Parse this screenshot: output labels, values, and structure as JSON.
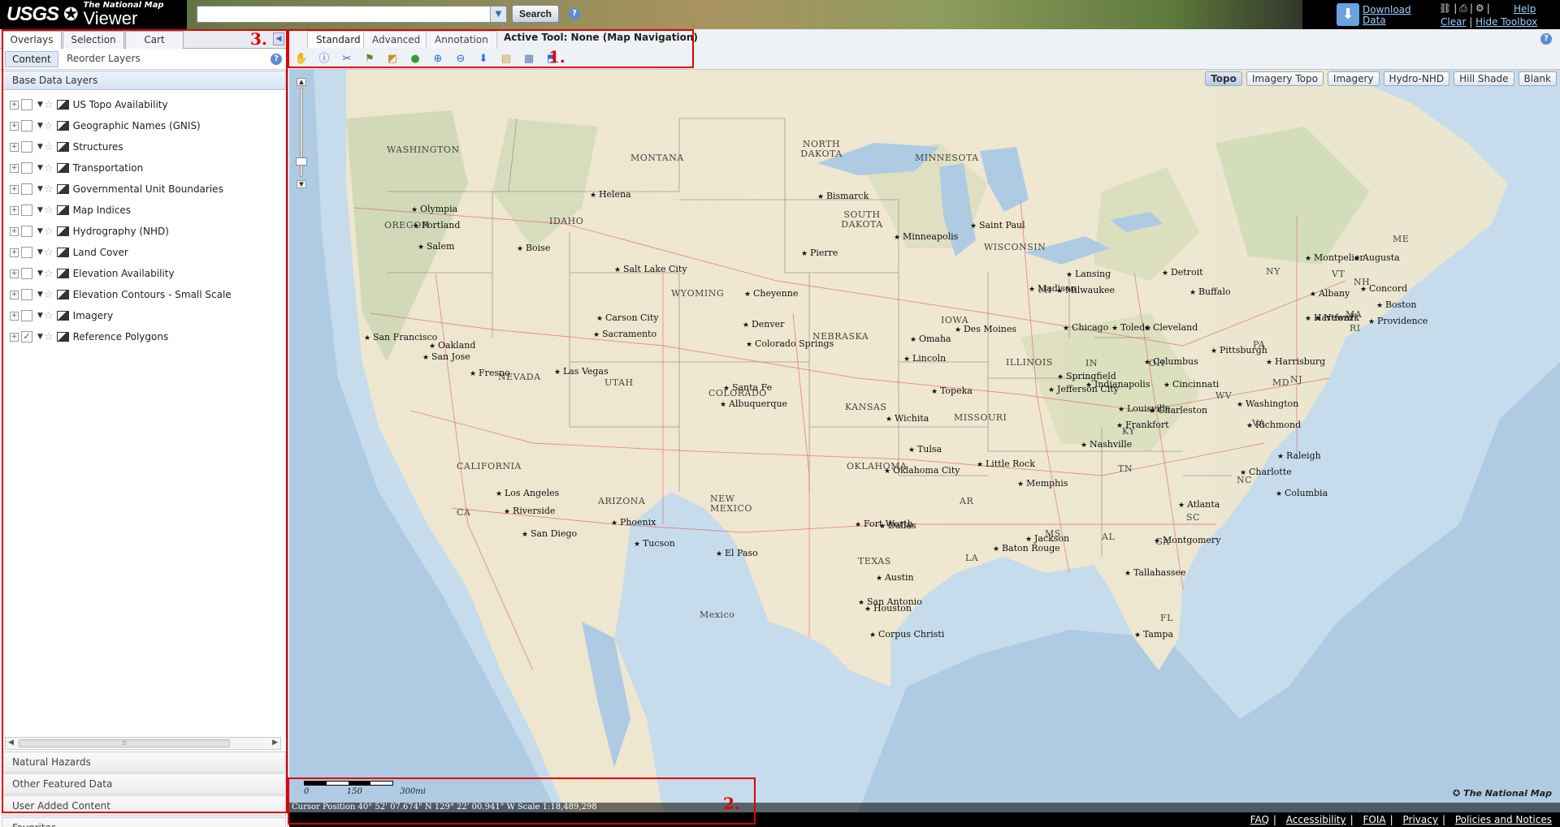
{
  "header": {
    "logo_usgs": "USGS",
    "logo_tnm_small": "The National Map",
    "logo_tnm_big": "Viewer",
    "search_value": "",
    "search_label": "Search",
    "download_label_1": "Download",
    "download_label_2": "Data",
    "help_label": "Help",
    "clear_label": "Clear",
    "hide_toolbox_label": "Hide Toolbox",
    "link_sep": "|"
  },
  "left_panel": {
    "tabs": [
      "Overlays",
      "Selection",
      "Cart"
    ],
    "subtabs": [
      "Content",
      "Reorder Layers"
    ],
    "base_header": "Base Data Layers",
    "layers": [
      {
        "label": "US Topo Availability",
        "checked": ""
      },
      {
        "label": "Geographic Names (GNIS)",
        "checked": ""
      },
      {
        "label": "Structures",
        "checked": ""
      },
      {
        "label": "Transportation",
        "checked": ""
      },
      {
        "label": "Governmental Unit Boundaries",
        "checked": ""
      },
      {
        "label": "Map Indices",
        "checked": ""
      },
      {
        "label": "Hydrography (NHD)",
        "checked": ""
      },
      {
        "label": "Land Cover",
        "checked": ""
      },
      {
        "label": "Elevation Availability",
        "checked": ""
      },
      {
        "label": "Elevation Contours - Small Scale",
        "checked": ""
      },
      {
        "label": "Imagery",
        "checked": ""
      },
      {
        "label": "Reference Polygons",
        "checked": "✓"
      }
    ],
    "accordion": [
      "Natural Hazards",
      "Other Featured Data",
      "User Added Content",
      "Favorites"
    ]
  },
  "toolbar": {
    "tabs": [
      "Standard",
      "Advanced",
      "Annotation"
    ],
    "active_tool": "Active Tool: None (Map Navigation)",
    "tools": [
      {
        "name": "pan-hand-icon",
        "glyph": "✋",
        "color": "#d08a1a"
      },
      {
        "name": "identify-info-icon",
        "glyph": "ⓘ",
        "color": "#2a6bd0"
      },
      {
        "name": "measure-icon",
        "glyph": "✂",
        "color": "#2a6bd0"
      },
      {
        "name": "flag-icon",
        "glyph": "⚑",
        "color": "#5a8a2a"
      },
      {
        "name": "bookmark-icon",
        "glyph": "◩",
        "color": "#d08a1a"
      },
      {
        "name": "globe-icon",
        "glyph": "●",
        "color": "#3a9a3a"
      },
      {
        "name": "zoom-in-icon",
        "glyph": "⊕",
        "color": "#2a6bd0"
      },
      {
        "name": "zoom-out-icon",
        "glyph": "⊖",
        "color": "#2a6bd0"
      },
      {
        "name": "download-icon",
        "glyph": "⬇",
        "color": "#2a6bd0"
      },
      {
        "name": "legend-icon",
        "glyph": "▤",
        "color": "#c8a040"
      },
      {
        "name": "print-icon",
        "glyph": "▦",
        "color": "#5a7ab0"
      },
      {
        "name": "share-icon",
        "glyph": "⬒",
        "color": "#2a6bd0"
      }
    ]
  },
  "map": {
    "basemaps": [
      "Topo",
      "Imagery Topo",
      "Imagery",
      "Hydro-NHD",
      "Hill Shade",
      "Blank"
    ],
    "scale_ticks": [
      "0",
      "150",
      "300mi"
    ],
    "watermark": "The National Map",
    "cursor_text": "Cursor Position  40° 52' 07.674\" N     129° 22' 00.941\" W        Scale  1:18,489,298",
    "states": [
      "WASHINGTON",
      "MONTANA",
      "NORTH DAKOTA",
      "MINNESOTA",
      "OREGON",
      "IDAHO",
      "SOUTH DAKOTA",
      "WISCONSIN",
      "WYOMING",
      "IOWA",
      "NEBRASKA",
      "NEVADA",
      "UTAH",
      "COLORADO",
      "KANSAS",
      "MISSOURI",
      "ILLINOIS",
      "CALIFORNIA",
      "ARIZONA",
      "NEW MEXICO",
      "OKLAHOMA",
      "TEXAS",
      "MI",
      "IN",
      "OH",
      "PA",
      "NY",
      "VT",
      "NH",
      "ME",
      "MA",
      "RI",
      "WV",
      "VA",
      "KY",
      "TN",
      "AR",
      "MS",
      "AL",
      "GA",
      "SC",
      "NC",
      "LA",
      "FL",
      "MD",
      "NJ",
      "CA",
      "Mexico"
    ],
    "cities": [
      "Olympia",
      "Portland",
      "Salem",
      "Helena",
      "Bismarck",
      "Boise",
      "Pierre",
      "Minneapolis",
      "Saint Paul",
      "Salt Lake City",
      "Cheyenne",
      "Carson City",
      "Sacramento",
      "San Francisco",
      "Oakland",
      "San Jose",
      "Fresno",
      "Las Vegas",
      "Los Angeles",
      "Riverside",
      "San Diego",
      "Phoenix",
      "Tucson",
      "Santa Fe",
      "Albuquerque",
      "El Paso",
      "Denver",
      "Colorado Springs",
      "Lincoln",
      "Omaha",
      "Des Moines",
      "Madison",
      "Milwaukee",
      "Chicago",
      "Lansing",
      "Detroit",
      "Toledo",
      "Cleveland",
      "Buffalo",
      "Montpelier",
      "Augusta",
      "Concord",
      "Albany",
      "Boston",
      "Hartford",
      "Providence",
      "Pittsburgh",
      "Harrisburg",
      "Newark",
      "Columbus",
      "Indianapolis",
      "Springfield",
      "Jefferson City",
      "Topeka",
      "Wichita",
      "Tulsa",
      "Oklahoma City",
      "Little Rock",
      "Memphis",
      "Nashville",
      "Louisville",
      "Frankfort",
      "Cincinnati",
      "Charleston",
      "Washington",
      "Richmond",
      "Raleigh",
      "Charlotte",
      "Columbia",
      "Atlanta",
      "Montgomery",
      "Jackson",
      "Baton Rouge",
      "Tallahassee",
      "Tampa",
      "Houston",
      "Austin",
      "San Antonio",
      "Corpus Christi",
      "Dallas",
      "Fort Worth"
    ]
  },
  "footer": {
    "links": [
      "FAQ",
      "Accessibility",
      "FOIA",
      "Privacy",
      "Policies and Notices"
    ]
  },
  "annotations": [
    "1.",
    "2.",
    "3."
  ]
}
